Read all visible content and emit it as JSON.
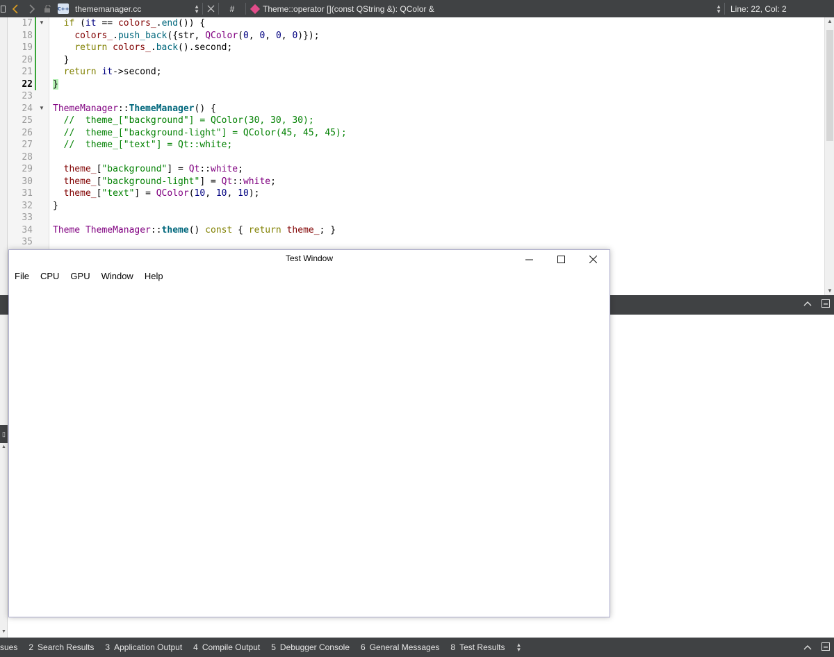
{
  "toolbar": {
    "file_name": "thememanager.cc",
    "file_icon_label": "C++",
    "hash_label": "#",
    "symbol": "Theme::operator [](const QString &): QColor &",
    "position": "Line: 22, Col: 2"
  },
  "editor": {
    "lines": [
      {
        "num": "17"
      },
      {
        "num": "18"
      },
      {
        "num": "19"
      },
      {
        "num": "20"
      },
      {
        "num": "21"
      },
      {
        "num": "22"
      },
      {
        "num": "23"
      },
      {
        "num": "24"
      },
      {
        "num": "25"
      },
      {
        "num": "26"
      },
      {
        "num": "27"
      },
      {
        "num": "28"
      },
      {
        "num": "29"
      },
      {
        "num": "30"
      },
      {
        "num": "31"
      },
      {
        "num": "32"
      },
      {
        "num": "33"
      },
      {
        "num": "34"
      },
      {
        "num": "35"
      }
    ],
    "current_line": "22",
    "code": {
      "l17_if": "if",
      "l17_rest_a": " (",
      "l17_it": "it",
      "l17_rest_b": " == ",
      "l17_colors": "colors_",
      "l17_rest_c": ".",
      "l17_end": "end",
      "l17_rest_d": "()) {",
      "l18_colors": "colors_",
      "l18_rest_a": ".",
      "l18_push": "push_back",
      "l18_rest_b": "({str, ",
      "l18_qcolor": "QColor",
      "l18_rest_c": "(",
      "l18_n1": "0",
      "l18_c1": ", ",
      "l18_n2": "0",
      "l18_c2": ", ",
      "l18_n3": "0",
      "l18_c3": ", ",
      "l18_n4": "0",
      "l18_rest_d": ")});",
      "l19_return": "return",
      "l19_sp": " ",
      "l19_colors": "colors_",
      "l19_rest_a": ".",
      "l19_back": "back",
      "l19_rest_b": "().second;",
      "l20": "}",
      "l21_return": "return",
      "l21_sp": " ",
      "l21_it": "it",
      "l21_rest": "->second;",
      "l22": "}",
      "l24_class": "ThemeManager",
      "l24_scope": "::",
      "l24_ctor": "ThemeManager",
      "l24_rest": "() {",
      "l25": "//  theme_[\"background\"] = QColor(30, 30, 30);",
      "l26": "//  theme_[\"background-light\"] = QColor(45, 45, 45);",
      "l27": "//  theme_[\"text\"] = Qt::white;",
      "l29_var": "theme_",
      "l29_a": "[",
      "l29_str": "\"background\"",
      "l29_b": "] = ",
      "l29_qt": "Qt",
      "l29_scope": "::",
      "l29_white": "white",
      "l29_c": ";",
      "l30_var": "theme_",
      "l30_a": "[",
      "l30_str": "\"background-light\"",
      "l30_b": "] = ",
      "l30_qt": "Qt",
      "l30_scope": "::",
      "l30_white": "white",
      "l30_c": ";",
      "l31_var": "theme_",
      "l31_a": "[",
      "l31_str": "\"text\"",
      "l31_b": "] = ",
      "l31_qcolor": "QColor",
      "l31_c": "(",
      "l31_n1": "10",
      "l31_d": ", ",
      "l31_n2": "10",
      "l31_e": ", ",
      "l31_n3": "10",
      "l31_f": ");",
      "l32": "}",
      "l34_theme": "Theme",
      "l34_sp1": " ",
      "l34_class": "ThemeManager",
      "l34_scope": "::",
      "l34_fn": "theme",
      "l34_a": "() ",
      "l34_const": "const",
      "l34_b": " { ",
      "l34_return": "return",
      "l34_sp2": " ",
      "l34_var": "theme_",
      "l34_c": "; }"
    }
  },
  "test_window": {
    "title": "Test Window",
    "menu": [
      "File",
      "CPU",
      "GPU",
      "Window",
      "Help"
    ]
  },
  "left_panel": {
    "partial_tab": "sues"
  },
  "tabs": [
    {
      "num": "2",
      "label": "Search Results"
    },
    {
      "num": "3",
      "label": "Application Output"
    },
    {
      "num": "4",
      "label": "Compile Output"
    },
    {
      "num": "5",
      "label": "Debugger Console"
    },
    {
      "num": "6",
      "label": "General Messages"
    },
    {
      "num": "8",
      "label": "Test Results"
    }
  ],
  "colors": {
    "toolbar_bg": "#404244",
    "keyword": "#808000",
    "member": "#800000",
    "type": "#800080",
    "number": "#000080",
    "string": "#008000",
    "function": "#00677c",
    "change_marker": "#37a537"
  }
}
